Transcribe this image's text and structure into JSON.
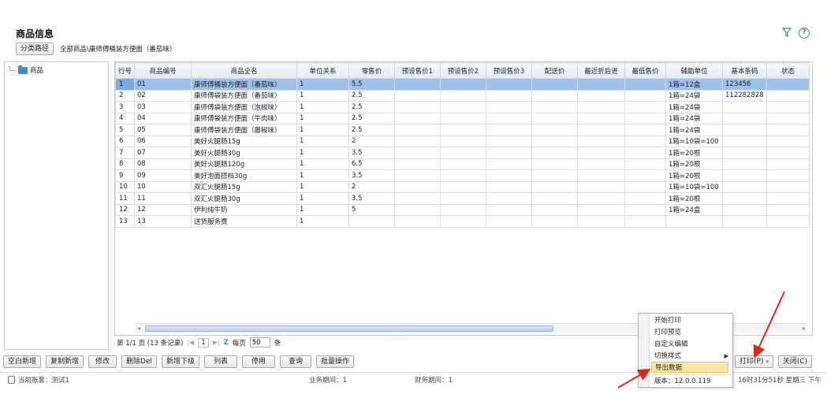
{
  "header": {
    "title": "商品信息",
    "filter_icon": "filter-icon",
    "help_icon": "help-icon"
  },
  "path": {
    "button_label": "分类路径",
    "text": "全部商品\\康师傅桶装方便面（番茄味）"
  },
  "tree": {
    "root_label": "商品",
    "root_icon": "folder-icon"
  },
  "grid": {
    "columns": [
      "行号",
      "商品编号",
      "商品全名",
      "单位关系",
      "零售价",
      "预设售价1",
      "预设售价2",
      "预设售价3",
      "配送价",
      "最近折后进",
      "最低售价",
      "辅助单位",
      "基本条码",
      "状态"
    ],
    "rows": [
      [
        "1",
        "01",
        "康师傅桶装方便面（番茄味）",
        "1",
        "5.5",
        "",
        "",
        "",
        "",
        "",
        "",
        "1箱=12盒",
        "123456",
        ""
      ],
      [
        "2",
        "02",
        "康师傅袋装方便面（番茄味）",
        "1",
        "2.5",
        "",
        "",
        "",
        "",
        "",
        "",
        "1箱=24袋",
        "112282828",
        ""
      ],
      [
        "3",
        "03",
        "康师傅袋装方便面（泡椒味）",
        "1",
        "2.5",
        "",
        "",
        "",
        "",
        "",
        "",
        "1箱=24袋",
        "",
        ""
      ],
      [
        "4",
        "04",
        "康师傅袋装方便面（牛肉味）",
        "1",
        "2.5",
        "",
        "",
        "",
        "",
        "",
        "",
        "1箱=24袋",
        "",
        ""
      ],
      [
        "5",
        "05",
        "康师傅袋装方便面（藤椒味）",
        "1",
        "2.5",
        "",
        "",
        "",
        "",
        "",
        "",
        "1箱=24袋",
        "",
        ""
      ],
      [
        "6",
        "06",
        "美好火腿肠15g",
        "1",
        "2",
        "",
        "",
        "",
        "",
        "",
        "",
        "1箱=10袋=100",
        "",
        ""
      ],
      [
        "7",
        "07",
        "美好火腿肠30g",
        "1",
        "3.5",
        "",
        "",
        "",
        "",
        "",
        "",
        "1箱=20根",
        "",
        ""
      ],
      [
        "8",
        "08",
        "美好火腿肠120g",
        "1",
        "6.5",
        "",
        "",
        "",
        "",
        "",
        "",
        "1箱=20根",
        "",
        ""
      ],
      [
        "9",
        "09",
        "美好泡面搭档30g",
        "1",
        "3.5",
        "",
        "",
        "",
        "",
        "",
        "",
        "1箱=20根",
        "",
        ""
      ],
      [
        "10",
        "10",
        "双汇火腿肠15g",
        "1",
        "2",
        "",
        "",
        "",
        "",
        "",
        "",
        "1箱=10袋=100",
        "",
        ""
      ],
      [
        "11",
        "11",
        "双汇火腿肠30g",
        "1",
        "3.5",
        "",
        "",
        "",
        "",
        "",
        "",
        "1箱=20根",
        "",
        ""
      ],
      [
        "12",
        "12",
        "伊利纯牛奶",
        "1",
        "5",
        "",
        "",
        "",
        "",
        "",
        "",
        "1箱=24盒",
        "",
        ""
      ],
      [
        "13",
        "13",
        "送货服务费",
        "1",
        "",
        "",
        "",
        "",
        "",
        "",
        "",
        "",
        "",
        ""
      ]
    ],
    "selected_row": 1
  },
  "pager": {
    "info": "第 1/1 页 (13 条记录)",
    "first": "◀",
    "prev": "◀",
    "current": "1",
    "next": "▶",
    "last": "▶",
    "refresh": "Z",
    "per_page_label": "每页",
    "per_page_value": "50",
    "unit": "条"
  },
  "toolbar": {
    "buttons": [
      "空白新增",
      "复制新增",
      "修改",
      "删除Del",
      "新增下级",
      "列表",
      "停用",
      "查询",
      "批量操作"
    ],
    "print_label": "打印(P)",
    "close_label": "关闭(C)"
  },
  "context_menu": {
    "items": [
      "开始打印",
      "打印预览",
      "自定义编辑",
      "切换样式",
      "导出数据",
      "版本：12.0.0.119"
    ],
    "highlighted": "导出数据"
  },
  "status": {
    "account": "当前账套：测试1",
    "business_period": "业务期间：1",
    "finance_period": "财务期间：1",
    "clock": "16时31分51秒 星期三 下午"
  },
  "colors": {
    "selected_row": "#9bc1ec",
    "accent": "#3a7fd5",
    "menu_highlight": "#fbe8a6",
    "arrow": "#e0261b"
  }
}
